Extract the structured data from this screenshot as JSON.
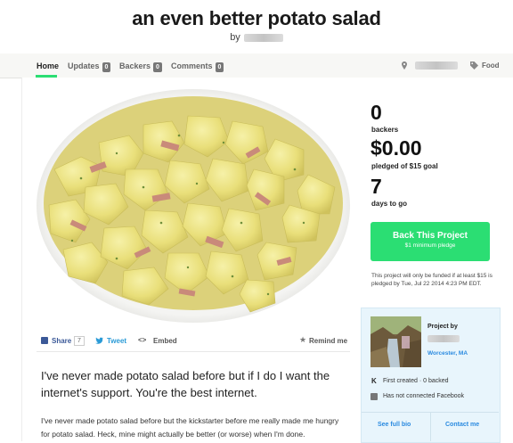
{
  "project": {
    "title": "an even better potato salad",
    "by_label": "by"
  },
  "tabs": [
    {
      "label": "Home",
      "count": null
    },
    {
      "label": "Updates",
      "count": "0"
    },
    {
      "label": "Backers",
      "count": "0"
    },
    {
      "label": "Comments",
      "count": "0"
    }
  ],
  "meta": {
    "category": "Food",
    "location_icon": "map-pin-icon",
    "category_icon": "tag-icon"
  },
  "share": {
    "facebook_label": "Share",
    "facebook_count": "7",
    "tweet_label": "Tweet",
    "embed_label": "Embed",
    "embed_glyph": "<>",
    "remind_label": "Remind me"
  },
  "description": {
    "lead": "I've never made potato salad before but if I do I want the internet's support. You're the best internet.",
    "body": "I've never made potato salad before but the kickstarter before me really made me hungry for potato salad. Heck, mine might actually be better (or worse) when I'm done."
  },
  "stats": {
    "backers_value": "0",
    "backers_label": "backers",
    "pledged_value": "$0.00",
    "pledged_label": "pledged of $15 goal",
    "days_value": "7",
    "days_label": "days to go"
  },
  "back_button": {
    "label": "Back This Project",
    "sublabel": "$1 minimum pledge"
  },
  "funding_note": "This project will only be funded if at least $15 is pledged by Tue, Jul 22 2014 4:23 PM EDT.",
  "creator": {
    "heading": "Project by",
    "location": "Worcester, MA",
    "first_created": "First created · 0 backed",
    "facebook_status": "Has not connected Facebook",
    "full_bio_label": "See full bio",
    "contact_label": "Contact me"
  },
  "colors": {
    "accent_green": "#2bde73",
    "link_blue": "#2a8ae0",
    "facebook_blue": "#3b5998",
    "twitter_blue": "#2b9bd7"
  }
}
